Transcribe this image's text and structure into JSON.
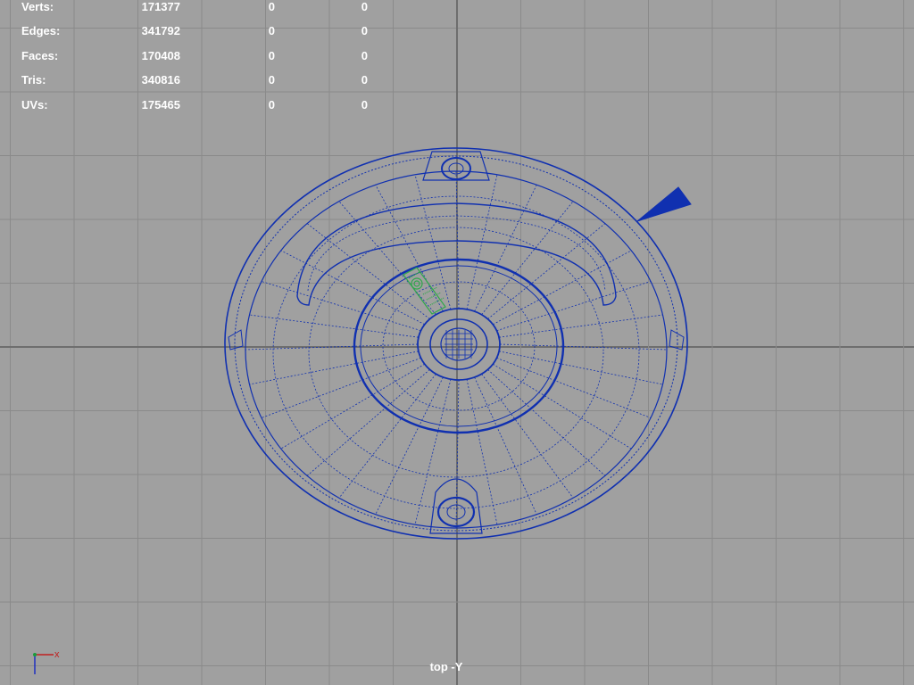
{
  "hud": {
    "stats": [
      {
        "label": "Verts:",
        "value": "171377",
        "selected": "0",
        "total": "0"
      },
      {
        "label": "Edges:",
        "value": "341792",
        "selected": "0",
        "total": "0"
      },
      {
        "label": "Faces:",
        "value": "170408",
        "selected": "0",
        "total": "0"
      },
      {
        "label": "Tris:",
        "value": "340816",
        "selected": "0",
        "total": "0"
      },
      {
        "label": "UVs:",
        "value": "175465",
        "selected": "0",
        "total": "0"
      }
    ]
  },
  "viewport": {
    "view_label": "top -Y",
    "axis_x_label": "x",
    "colors": {
      "background": "#a0a0a0",
      "grid": "#8a8a8a",
      "grid_axis": "#6e6e6e",
      "wireframe": "#1030b0",
      "selection": "#2ea84a"
    }
  }
}
